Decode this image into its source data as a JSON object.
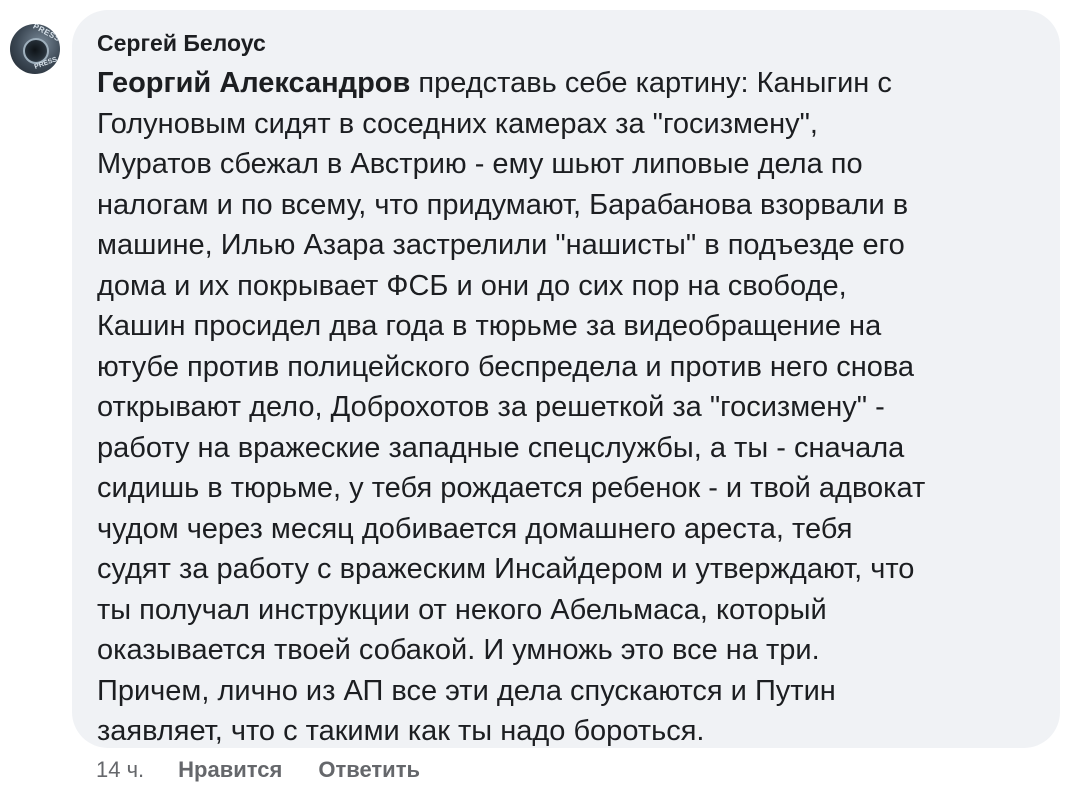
{
  "comment": {
    "author": "Сергей Белоус",
    "mention": "Георгий Александров",
    "lines": [
      " представь себе картину: Каныгин с",
      "Голуновым сидят в соседних камерах за \"госизмену\",",
      "Муратов сбежал в Австрию - ему шьют липовые дела по",
      "налогам и по всему, что придумают, Барабанова взорвали в",
      "машине, Илью Азара застрелили \"нашисты\" в подъезде его",
      "дома и их покрывает ФСБ и они до сих пор на свободе,",
      "Кашин просидел два года в тюрьме за видеобращение на",
      "ютубе против полицейского беспредела и против него снова",
      "открывают дело, Доброхотов за решеткой за \"госизмену\" -",
      "работу на вражеские западные спецслужбы, а ты - сначала",
      "сидишь в тюрьме, у тебя рождается ребенок - и твой адвокат",
      "чудом через месяц добивается домашнего ареста, тебя",
      "судят за работу с вражеским Инсайдером и утверждают, что",
      "ты получал инструкции от некого Абельмаса, который",
      "оказывается твоей собакой. И умножь это все на три.",
      "Причем, лично из АП все эти дела спускаются и Путин",
      "заявляет, что с такими как ты надо бороться."
    ],
    "time": "14 ч.",
    "like_label": "Нравится",
    "reply_label": "Ответить",
    "avatar_text_top": "PRESS",
    "avatar_text_bottom": "PRESS"
  },
  "colors": {
    "bubble_background": "#f0f2f5",
    "text": "#1c1e21",
    "secondary_text": "#65676b"
  },
  "icons": {
    "avatar": "camera-photo-avatar"
  }
}
